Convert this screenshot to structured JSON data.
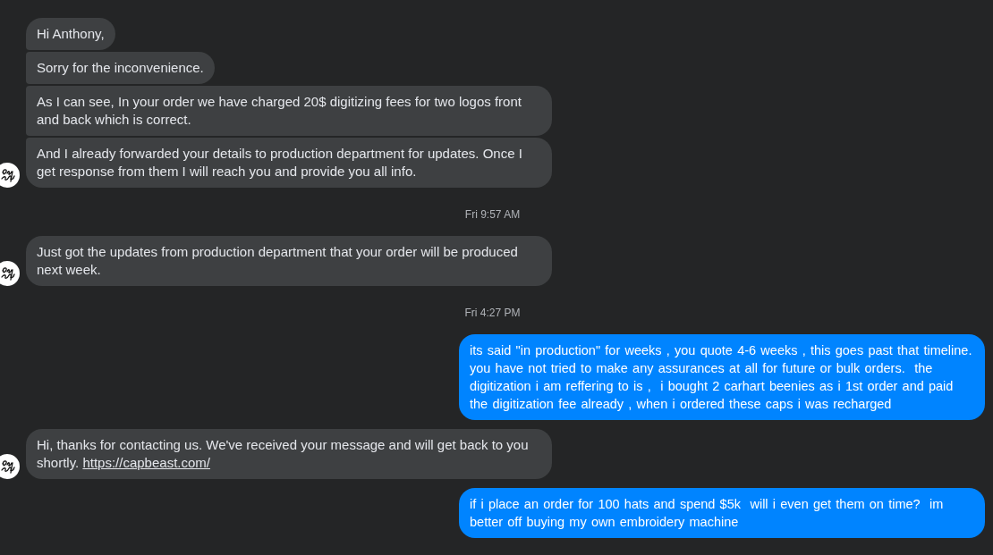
{
  "conversation": [
    {
      "kind": "received",
      "messages": [
        {
          "text": "Hi Anthony,"
        },
        {
          "text": "Sorry for the inconvenience."
        },
        {
          "text": "As I can see, In your order we have charged 20$ digitizing fees for two logos front and back which is correct."
        },
        {
          "text": "And I already forwarded your details to production department for updates. Once I get response from them I will reach you and provide you all info."
        }
      ]
    },
    {
      "kind": "timestamp",
      "text": "Fri 9:57 AM"
    },
    {
      "kind": "received",
      "messages": [
        {
          "text": "Just got the updates from production department that your order will be produced next week."
        }
      ]
    },
    {
      "kind": "timestamp",
      "text": "Fri 4:27 PM"
    },
    {
      "kind": "sent",
      "messages": [
        {
          "text": "its said \"in production\" for weeks , you quote 4-6 weeks , this goes past that timeline. you have not tried to make any assurances at all for future or bulk orders.  the digitization i am reffering to is ,  i bought 2 carhart beenies as i 1st order and paid the digitization fee already , when i ordered these caps i was recharged"
        }
      ]
    },
    {
      "kind": "received",
      "messages": [
        {
          "text": "Hi, thanks for contacting us. We've received your message and will get back to you shortly.",
          "link": "https://capbeast.com/"
        }
      ]
    },
    {
      "kind": "sent",
      "messages": [
        {
          "text": "if i place an order for 100 hats and spend $5k  will i even get them on time?  im better off buying my own embroidery machine"
        }
      ]
    }
  ]
}
